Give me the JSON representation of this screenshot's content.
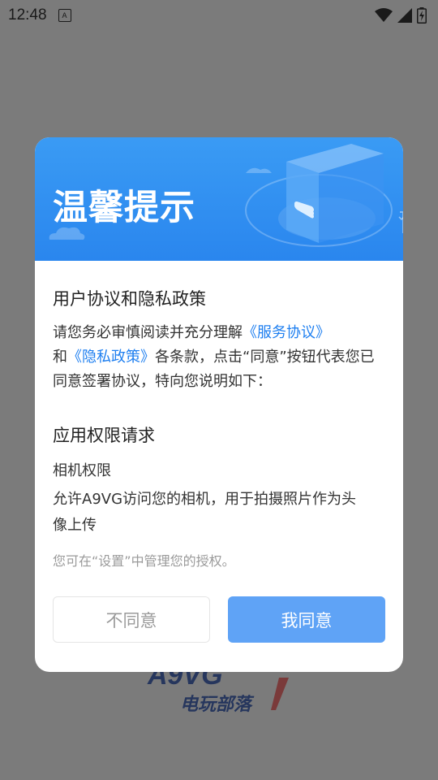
{
  "status_bar": {
    "time": "12:48",
    "notification_glyph": "A",
    "icons": [
      "wifi-icon",
      "cell-signal-icon",
      "battery-charging-icon"
    ]
  },
  "background": {
    "logo_text_top": "A9VG",
    "logo_text_bottom": "电玩部落"
  },
  "dialog": {
    "title": "温馨提示",
    "section1_title": "用户协议和隐私政策",
    "intro_prefix": "请您务必审慎阅读并充分理解",
    "service_link": "《服务协议》",
    "and_text": "和",
    "privacy_link": "《隐私政策》",
    "intro_suffix": "各条款，点击“同意”按钮代表您已同意签署协议，特向您说明如下：",
    "section2_title": "应用权限请求",
    "permission_name": "相机权限",
    "permission_desc": "允许A9VG访问您的相机，用于拍摄照片作为头像上传",
    "hint": "您可在“设置”中管理您的授权。",
    "disagree_label": "不同意",
    "agree_label": "我同意"
  },
  "colors": {
    "header_blue": "#2a86ee",
    "link_blue": "#1e7ff0",
    "agree_button": "#5fa3f6",
    "overlay": "#7b7b7b"
  }
}
